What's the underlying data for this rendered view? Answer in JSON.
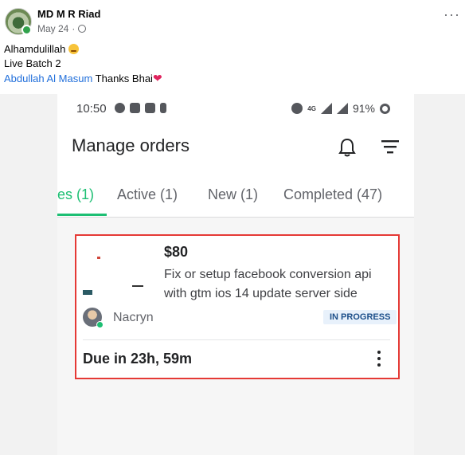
{
  "post": {
    "author": "MD M R Riad",
    "date": "May 24",
    "line1": "Alhamdulillah",
    "line2": "Live Batch 2",
    "mention": "Abdullah Al Masum",
    "thanks": "Thanks Bhai",
    "more": "···"
  },
  "status_bar": {
    "time": "10:50",
    "network": "4G",
    "battery": "91%"
  },
  "app": {
    "title": "Manage orders"
  },
  "tabs": [
    {
      "label": "es (1)",
      "active": true
    },
    {
      "label": "Active (1)",
      "active": false
    },
    {
      "label": "New (1)",
      "active": false
    },
    {
      "label": "Completed (47)",
      "active": false
    }
  ],
  "order": {
    "price": "$80",
    "gig_line1": "Fix or setup facebook conversion api",
    "gig_line2": "with gtm ios 14 update server side",
    "buyer": "Nacryn",
    "status": "IN PROGRESS",
    "due": "Due in 23h, 59m"
  },
  "colors": {
    "accent": "#1dbf73",
    "highlight": "#e53935",
    "link": "#216fdb"
  },
  "icons": [
    "globe-icon",
    "bell-icon",
    "filter-icon",
    "kebab-menu-icon"
  ]
}
